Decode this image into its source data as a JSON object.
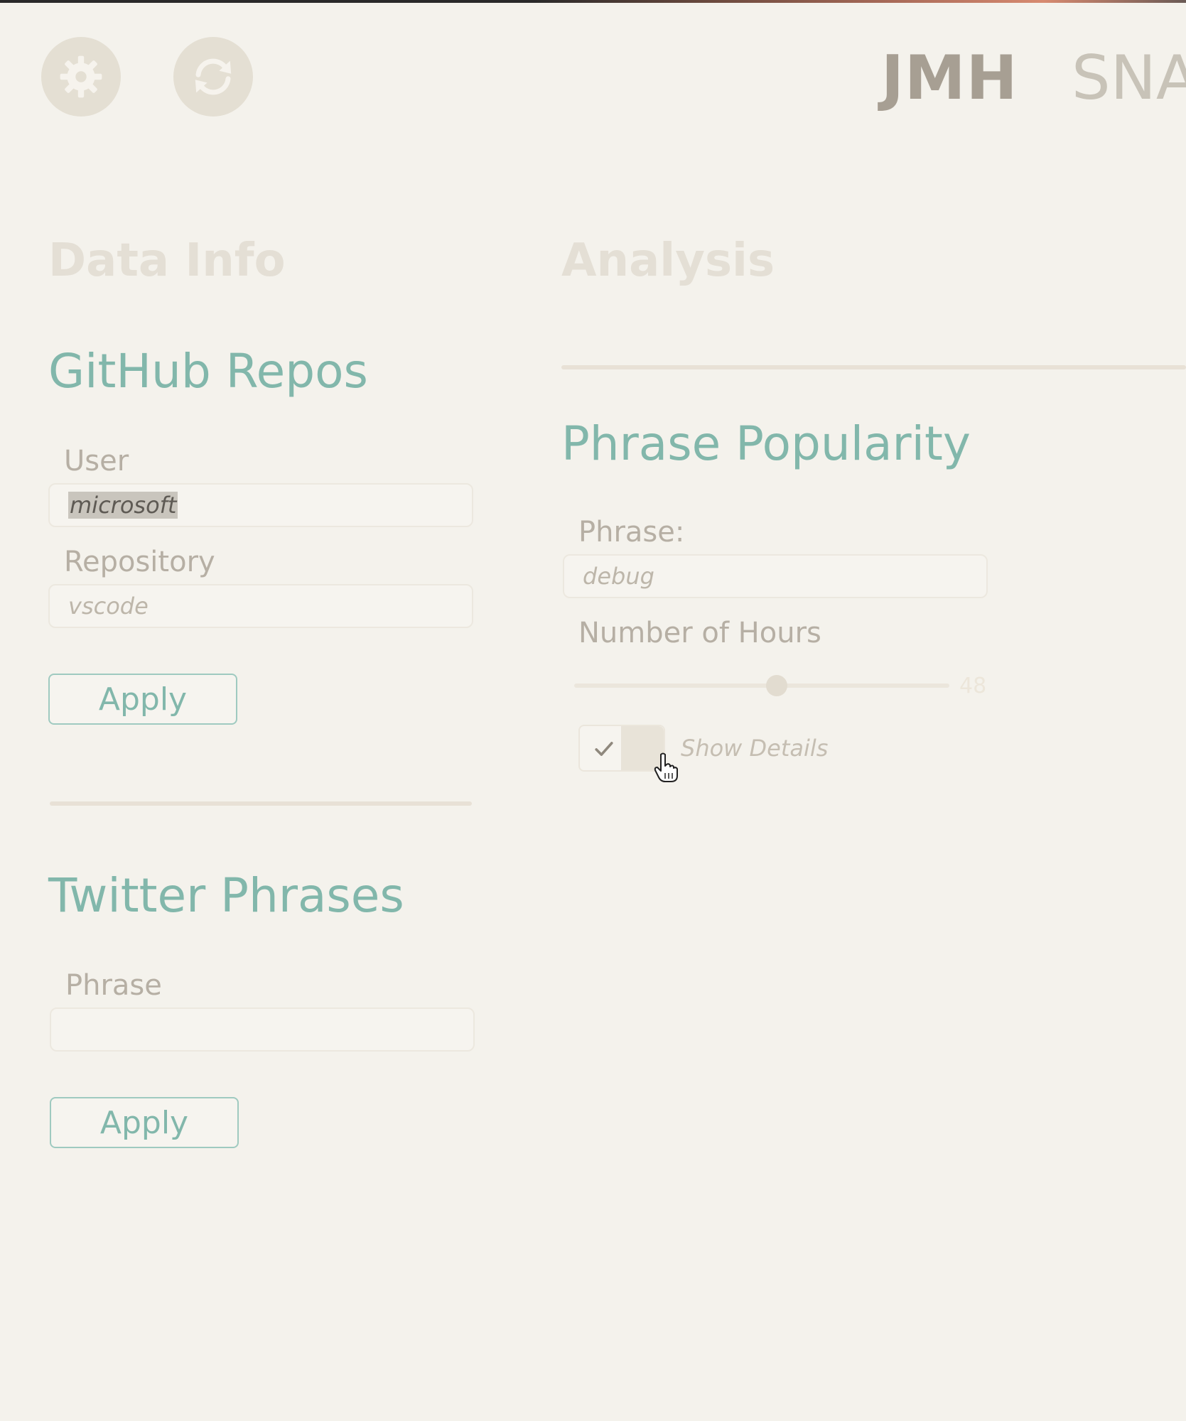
{
  "header": {
    "settings_icon": "gear-icon",
    "refresh_icon": "refresh-icon",
    "brand_primary": "JMH",
    "brand_secondary": "SNA"
  },
  "sections": {
    "data_info": "Data Info",
    "analysis": "Analysis"
  },
  "github": {
    "title": "GitHub Repos",
    "user_label": "User",
    "user_value": "microsoft",
    "repo_label": "Repository",
    "repo_value": "vscode",
    "apply_label": "Apply"
  },
  "twitter": {
    "title": "Twitter Phrases",
    "phrase_label": "Phrase",
    "phrase_value": "",
    "apply_label": "Apply"
  },
  "phrase_popularity": {
    "title": "Phrase Popularity",
    "phrase_label": "Phrase:",
    "phrase_value": "debug",
    "hours_label": "Number of Hours",
    "hours_value": "48",
    "hours_fraction": 0.54,
    "show_details_label": "Show Details",
    "show_details_checked": true
  },
  "colors": {
    "background": "#f4f2ec",
    "accent": "#82b7ab",
    "muted": "#b6afa4"
  }
}
